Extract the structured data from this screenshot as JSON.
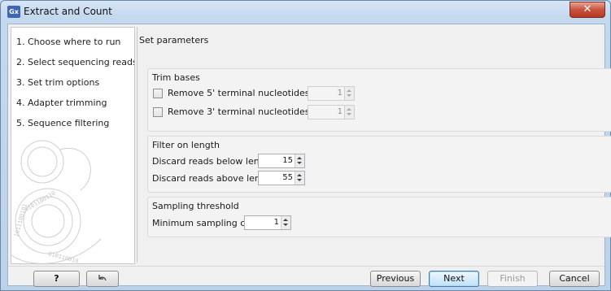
{
  "window": {
    "app_icon_label": "Gx",
    "title": "Extract and Count",
    "close_label": "✕"
  },
  "steps": [
    {
      "label": "1.  Choose where to run"
    },
    {
      "label": "2.  Select sequencing reads"
    },
    {
      "label": "3.  Set trim options"
    },
    {
      "label": "4.  Adapter trimming"
    },
    {
      "label": "5.  Sequence filtering"
    }
  ],
  "content": {
    "heading": "Set parameters",
    "trim_bases": {
      "title": "Trim bases",
      "remove5": {
        "label": "Remove 5' terminal nucleotides",
        "checked": false,
        "value": "1"
      },
      "remove3": {
        "label": "Remove 3' terminal nucleotides",
        "checked": false,
        "value": "1"
      }
    },
    "filter_length": {
      "title": "Filter on length",
      "below": {
        "label": "Discard reads below length",
        "value": "15"
      },
      "above": {
        "label": "Discard reads above length",
        "value": "55"
      }
    },
    "sampling": {
      "title": "Sampling threshold",
      "min_count": {
        "label": "Minimum sampling count",
        "value": "1"
      }
    }
  },
  "buttons": {
    "help": "?",
    "reset_icon": "reset-arrow-icon",
    "previous": "Previous",
    "next": "Next",
    "finish": "Finish",
    "cancel": "Cancel"
  }
}
